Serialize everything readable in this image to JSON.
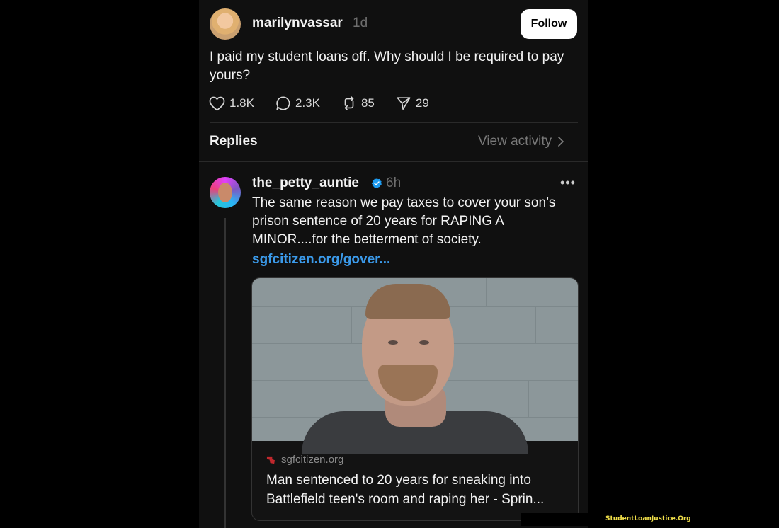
{
  "post": {
    "username": "marilynvassar",
    "time": "1d",
    "follow_label": "Follow",
    "text": "I paid my student loans off. Why should I be required to pay yours?",
    "likes": "1.8K",
    "replies": "2.3K",
    "reposts": "85",
    "shares": "29"
  },
  "replies_header": {
    "title": "Replies",
    "view_activity": "View activity"
  },
  "reply": {
    "username": "the_petty_auntie",
    "time": "6h",
    "more": "•••",
    "text": "The same reason we pay taxes to cover your son’s prison sentence of 20 years for RAPING A MINOR....for the betterment of society.",
    "link": "sgfcitizen.org/gover...",
    "card": {
      "domain": "sgfcitizen.org",
      "title": "Man sentenced to 20 years for sneaking into Battlefield teen's room and raping her - Sprin..."
    }
  },
  "watermark": "StudentLoanJustice.Org",
  "colors": {
    "background": "#101010",
    "link": "#3b9aea",
    "verified": "#1d9bf0",
    "muted": "#6e6e6e",
    "follow_bg": "#ffffff"
  },
  "icons": [
    "heart-icon",
    "comment-icon",
    "repost-icon",
    "share-icon",
    "chevron-right-icon",
    "verified-badge-icon",
    "more-icon",
    "site-favicon-icon"
  ]
}
